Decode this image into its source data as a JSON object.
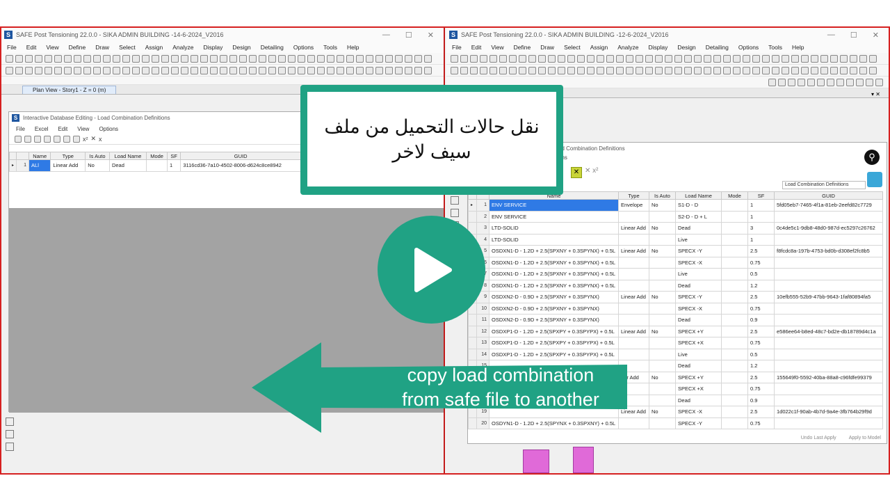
{
  "left_window": {
    "title": "SAFE Post Tensioning 22.0.0 - SIKA ADMIN BUILDING -14-6-2024_V2016",
    "menu": [
      "File",
      "Edit",
      "View",
      "Define",
      "Draw",
      "Select",
      "Assign",
      "Analyze",
      "Display",
      "Design",
      "Detailing",
      "Options",
      "Tools",
      "Help"
    ],
    "plan_tab": "Plan View - Story1 - Z = 0 (m)",
    "dialog": {
      "title": "Interactive Database Editing - Load Combination Definitions",
      "menu": [
        "File",
        "Excel",
        "Edit",
        "View",
        "Options"
      ],
      "columns": [
        "Name",
        "Type",
        "Is Auto",
        "Load Name",
        "Mode",
        "SF",
        "GUID"
      ],
      "rows": [
        {
          "num": "1",
          "name": "ALl",
          "type": "Linear Add",
          "auto": "No",
          "load": "Dead",
          "mode": "",
          "sf": "1",
          "guid": "3116cd36-7a10-4502-8006-d624c8ce8942"
        }
      ]
    }
  },
  "right_window": {
    "title": "SAFE Post Tensioning 22.0.0 - SIKA ADMIN BUILDING -12-6-2024_V2016",
    "menu": [
      "File",
      "Edit",
      "View",
      "Define",
      "Draw",
      "Select",
      "Assign",
      "Analyze",
      "Display",
      "Design",
      "Detailing",
      "Options",
      "Tools",
      "Help"
    ],
    "dialog": {
      "title_fragment": "ad Combination Definitions",
      "subtitle_fragment": "ons",
      "table_selector": "Load Combination Definitions",
      "columns": [
        "Name",
        "Type",
        "Is Auto",
        "Load Name",
        "Mode",
        "SF",
        "GUID"
      ],
      "rows": [
        {
          "num": "1",
          "name": "ENV SERVICE",
          "type": "Envelope",
          "auto": "No",
          "load": "S1-D - D",
          "mode": "",
          "sf": "1",
          "guid": "5fd05eb7-7465-4f1a-81eb-2eefd82c7729"
        },
        {
          "num": "2",
          "name": "ENV SERVICE",
          "type": "",
          "auto": "",
          "load": "S2-D - D + L",
          "mode": "",
          "sf": "1",
          "guid": ""
        },
        {
          "num": "3",
          "name": "LTD-SOLID",
          "type": "Linear Add",
          "auto": "No",
          "load": "Dead",
          "mode": "",
          "sf": "3",
          "guid": "0c4de5c1-9db8-48d0-987d-ec5297c26762"
        },
        {
          "num": "4",
          "name": "LTD-SOLID",
          "type": "",
          "auto": "",
          "load": "Live",
          "mode": "",
          "sf": "1",
          "guid": ""
        },
        {
          "num": "5",
          "name": "OSDXN1-D - 1.2D + 2.5(SPXNY + 0.3SPYNX) + 0.5L",
          "type": "Linear Add",
          "auto": "No",
          "load": "SPECX -Y",
          "mode": "",
          "sf": "2.5",
          "guid": "f8fcdc8a-197b-4753-bd0b-d308ef2fc8b5"
        },
        {
          "num": "6",
          "name": "OSDXN1-D - 1.2D + 2.5(SPXNY + 0.3SPYNX) + 0.5L",
          "type": "",
          "auto": "",
          "load": "SPECX -X",
          "mode": "",
          "sf": "0.75",
          "guid": ""
        },
        {
          "num": "7",
          "name": "OSDXN1-D - 1.2D + 2.5(SPXNY + 0.3SPYNX) + 0.5L",
          "type": "",
          "auto": "",
          "load": "Live",
          "mode": "",
          "sf": "0.5",
          "guid": ""
        },
        {
          "num": "8",
          "name": "OSDXN1-D - 1.2D + 2.5(SPXNY + 0.3SPYNX) + 0.5L",
          "type": "",
          "auto": "",
          "load": "Dead",
          "mode": "",
          "sf": "1.2",
          "guid": ""
        },
        {
          "num": "9",
          "name": "OSDXN2-D - 0.9D + 2.5(SPXNY + 0.3SPYNX)",
          "type": "Linear Add",
          "auto": "No",
          "load": "SPECX -Y",
          "mode": "",
          "sf": "2.5",
          "guid": "10efb555-52b9-47bb-9643-1faf80894fa5"
        },
        {
          "num": "10",
          "name": "OSDXN2-D - 0.9D + 2.5(SPXNY + 0.3SPYNX)",
          "type": "",
          "auto": "",
          "load": "SPECX -X",
          "mode": "",
          "sf": "0.75",
          "guid": ""
        },
        {
          "num": "11",
          "name": "OSDXN2-D - 0.9D + 2.5(SPXNY + 0.3SPYNX)",
          "type": "",
          "auto": "",
          "load": "Dead",
          "mode": "",
          "sf": "0.9",
          "guid": ""
        },
        {
          "num": "12",
          "name": "OSDXP1-D - 1.2D + 2.5(SPXPY + 0.3SPYPX) + 0.5L",
          "type": "Linear Add",
          "auto": "No",
          "load": "SPECX +Y",
          "mode": "",
          "sf": "2.5",
          "guid": "e586ee64-b8ed-48c7-bd2e-db18789d4c1a"
        },
        {
          "num": "13",
          "name": "OSDXP1-D - 1.2D + 2.5(SPXPY + 0.3SPYPX) + 0.5L",
          "type": "",
          "auto": "",
          "load": "SPECX +X",
          "mode": "",
          "sf": "0.75",
          "guid": ""
        },
        {
          "num": "14",
          "name": "OSDXP1-D - 1.2D + 2.5(SPXPY + 0.3SPYPX) + 0.5L",
          "type": "",
          "auto": "",
          "load": "Live",
          "mode": "",
          "sf": "0.5",
          "guid": ""
        },
        {
          "num": "15",
          "name": "",
          "type": "",
          "auto": "",
          "load": "Dead",
          "mode": "",
          "sf": "1.2",
          "guid": ""
        },
        {
          "num": "16",
          "name": "",
          "type": "ear Add",
          "auto": "No",
          "load": "SPECX +Y",
          "mode": "",
          "sf": "2.5",
          "guid": "155649f0-5592-40ba-88a8-c96fdfe99379"
        },
        {
          "num": "17",
          "name": "",
          "type": "",
          "auto": "",
          "load": "SPECX +X",
          "mode": "",
          "sf": "0.75",
          "guid": ""
        },
        {
          "num": "18",
          "name": "",
          "type": "",
          "auto": "",
          "load": "Dead",
          "mode": "",
          "sf": "0.9",
          "guid": ""
        },
        {
          "num": "19",
          "name": "",
          "type": "Linear Add",
          "auto": "No",
          "load": "SPECX -X",
          "mode": "",
          "sf": "2.5",
          "guid": "1d022c1f-90ab-4b7d-9a4e-3fb764b29f9d"
        },
        {
          "num": "20",
          "name": "OSDYN1-D - 1.2D + 2.5(SPYNX + 0.3SPXNY) + 0.5L",
          "type": "",
          "auto": "",
          "load": "SPECX -Y",
          "mode": "",
          "sf": "0.75",
          "guid": ""
        }
      ],
      "footer": {
        "undo": "Undo Last Apply",
        "apply": "Apply to Model"
      }
    }
  },
  "overlay": {
    "arabic_text": "نقل حالات التحميل من ملف سيف لاخر",
    "arrow_text_line1": "copy load combination",
    "arrow_text_line2": "from safe file to another",
    "accent_color": "#20a284"
  }
}
